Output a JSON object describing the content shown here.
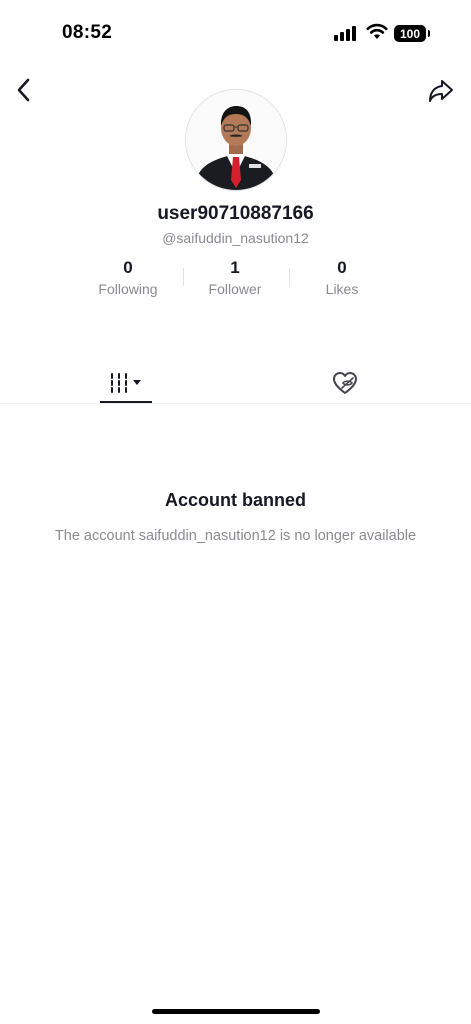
{
  "status_bar": {
    "time": "08:52",
    "battery": "100",
    "signal_icon": "cellular-signal-icon",
    "wifi_icon": "wifi-icon"
  },
  "nav": {
    "back_icon": "chevron-left-icon",
    "share_icon": "share-arrow-icon"
  },
  "profile": {
    "username": "user90710887166",
    "handle": "@saifuddin_nasution12"
  },
  "stats": [
    {
      "value": "0",
      "label": "Following"
    },
    {
      "value": "1",
      "label": "Follower"
    },
    {
      "value": "0",
      "label": "Likes"
    }
  ],
  "tabs": {
    "posts_icon": "grid-dropdown-icon",
    "liked_icon": "heart-hidden-icon"
  },
  "notice": {
    "title": "Account banned",
    "description": "The account saifuddin_nasution12 is no longer available"
  },
  "colors": {
    "text_primary": "#161823",
    "text_secondary": "#8a8b91",
    "background": "#ffffff"
  }
}
